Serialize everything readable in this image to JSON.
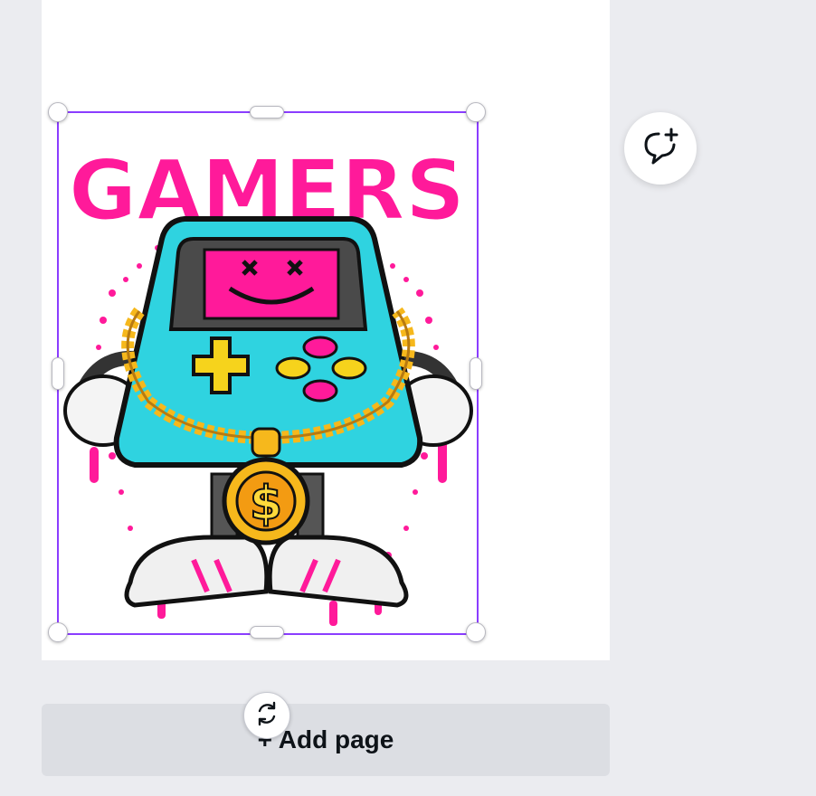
{
  "canvas": {
    "artwork_title": "GAMERS",
    "artwork_description_icon": "gamer-console-mascot"
  },
  "actions": {
    "add_page_label": "+ Add page",
    "comment_icon": "add-comment-icon",
    "rotate_icon": "rotate-icon"
  },
  "colors": {
    "selection": "#8b3dff",
    "magenta": "#ff1a9a",
    "cyan": "#2fd3e0",
    "gold": "#f6b81c"
  }
}
